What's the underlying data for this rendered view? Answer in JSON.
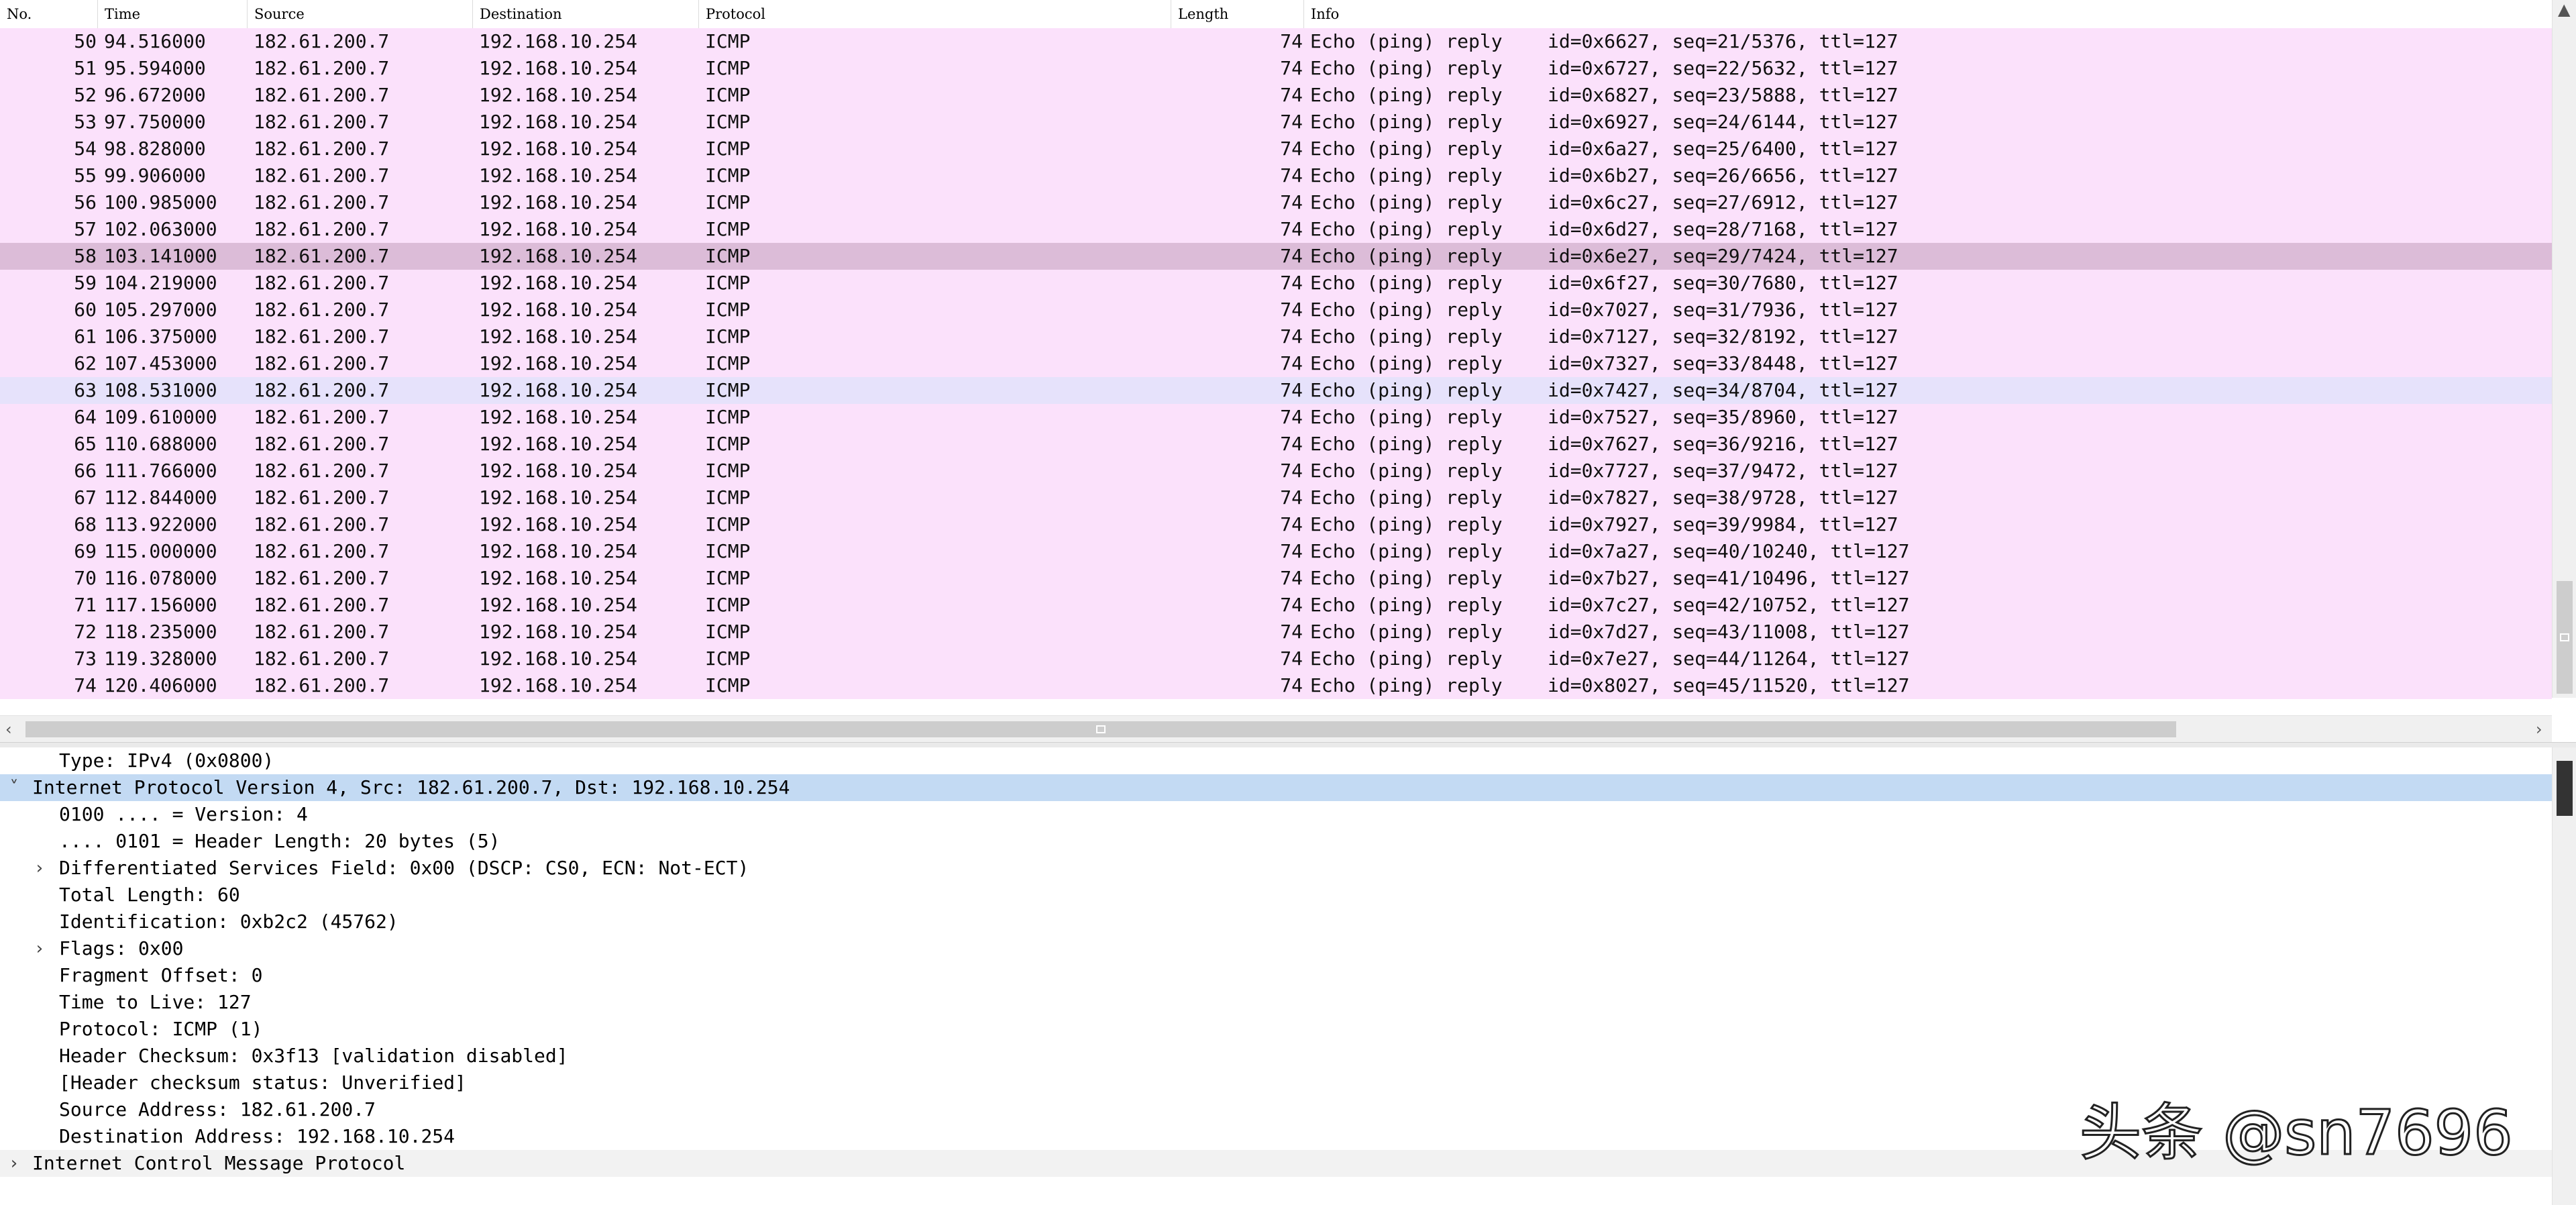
{
  "columns": {
    "no": "No.",
    "time": "Time",
    "source": "Source",
    "destination": "Destination",
    "protocol": "Protocol",
    "length": "Length",
    "info": "Info"
  },
  "packets": [
    {
      "no": "50",
      "time": "94.516000",
      "src": "182.61.200.7",
      "dst": "192.168.10.254",
      "proto": "ICMP",
      "len": "74",
      "info": "Echo (ping) reply    id=0x6627, seq=21/5376, ttl=127"
    },
    {
      "no": "51",
      "time": "95.594000",
      "src": "182.61.200.7",
      "dst": "192.168.10.254",
      "proto": "ICMP",
      "len": "74",
      "info": "Echo (ping) reply    id=0x6727, seq=22/5632, ttl=127"
    },
    {
      "no": "52",
      "time": "96.672000",
      "src": "182.61.200.7",
      "dst": "192.168.10.254",
      "proto": "ICMP",
      "len": "74",
      "info": "Echo (ping) reply    id=0x6827, seq=23/5888, ttl=127"
    },
    {
      "no": "53",
      "time": "97.750000",
      "src": "182.61.200.7",
      "dst": "192.168.10.254",
      "proto": "ICMP",
      "len": "74",
      "info": "Echo (ping) reply    id=0x6927, seq=24/6144, ttl=127"
    },
    {
      "no": "54",
      "time": "98.828000",
      "src": "182.61.200.7",
      "dst": "192.168.10.254",
      "proto": "ICMP",
      "len": "74",
      "info": "Echo (ping) reply    id=0x6a27, seq=25/6400, ttl=127"
    },
    {
      "no": "55",
      "time": "99.906000",
      "src": "182.61.200.7",
      "dst": "192.168.10.254",
      "proto": "ICMP",
      "len": "74",
      "info": "Echo (ping) reply    id=0x6b27, seq=26/6656, ttl=127"
    },
    {
      "no": "56",
      "time": "100.985000",
      "src": "182.61.200.7",
      "dst": "192.168.10.254",
      "proto": "ICMP",
      "len": "74",
      "info": "Echo (ping) reply    id=0x6c27, seq=27/6912, ttl=127"
    },
    {
      "no": "57",
      "time": "102.063000",
      "src": "182.61.200.7",
      "dst": "192.168.10.254",
      "proto": "ICMP",
      "len": "74",
      "info": "Echo (ping) reply    id=0x6d27, seq=28/7168, ttl=127"
    },
    {
      "no": "58",
      "time": "103.141000",
      "src": "182.61.200.7",
      "dst": "192.168.10.254",
      "proto": "ICMP",
      "len": "74",
      "info": "Echo (ping) reply    id=0x6e27, seq=29/7424, ttl=127",
      "state": "sel-gray"
    },
    {
      "no": "59",
      "time": "104.219000",
      "src": "182.61.200.7",
      "dst": "192.168.10.254",
      "proto": "ICMP",
      "len": "74",
      "info": "Echo (ping) reply    id=0x6f27, seq=30/7680, ttl=127"
    },
    {
      "no": "60",
      "time": "105.297000",
      "src": "182.61.200.7",
      "dst": "192.168.10.254",
      "proto": "ICMP",
      "len": "74",
      "info": "Echo (ping) reply    id=0x7027, seq=31/7936, ttl=127"
    },
    {
      "no": "61",
      "time": "106.375000",
      "src": "182.61.200.7",
      "dst": "192.168.10.254",
      "proto": "ICMP",
      "len": "74",
      "info": "Echo (ping) reply    id=0x7127, seq=32/8192, ttl=127"
    },
    {
      "no": "62",
      "time": "107.453000",
      "src": "182.61.200.7",
      "dst": "192.168.10.254",
      "proto": "ICMP",
      "len": "74",
      "info": "Echo (ping) reply    id=0x7327, seq=33/8448, ttl=127"
    },
    {
      "no": "63",
      "time": "108.531000",
      "src": "182.61.200.7",
      "dst": "192.168.10.254",
      "proto": "ICMP",
      "len": "74",
      "info": "Echo (ping) reply    id=0x7427, seq=34/8704, ttl=127",
      "state": "sel-blue"
    },
    {
      "no": "64",
      "time": "109.610000",
      "src": "182.61.200.7",
      "dst": "192.168.10.254",
      "proto": "ICMP",
      "len": "74",
      "info": "Echo (ping) reply    id=0x7527, seq=35/8960, ttl=127"
    },
    {
      "no": "65",
      "time": "110.688000",
      "src": "182.61.200.7",
      "dst": "192.168.10.254",
      "proto": "ICMP",
      "len": "74",
      "info": "Echo (ping) reply    id=0x7627, seq=36/9216, ttl=127"
    },
    {
      "no": "66",
      "time": "111.766000",
      "src": "182.61.200.7",
      "dst": "192.168.10.254",
      "proto": "ICMP",
      "len": "74",
      "info": "Echo (ping) reply    id=0x7727, seq=37/9472, ttl=127"
    },
    {
      "no": "67",
      "time": "112.844000",
      "src": "182.61.200.7",
      "dst": "192.168.10.254",
      "proto": "ICMP",
      "len": "74",
      "info": "Echo (ping) reply    id=0x7827, seq=38/9728, ttl=127"
    },
    {
      "no": "68",
      "time": "113.922000",
      "src": "182.61.200.7",
      "dst": "192.168.10.254",
      "proto": "ICMP",
      "len": "74",
      "info": "Echo (ping) reply    id=0x7927, seq=39/9984, ttl=127"
    },
    {
      "no": "69",
      "time": "115.000000",
      "src": "182.61.200.7",
      "dst": "192.168.10.254",
      "proto": "ICMP",
      "len": "74",
      "info": "Echo (ping) reply    id=0x7a27, seq=40/10240, ttl=127"
    },
    {
      "no": "70",
      "time": "116.078000",
      "src": "182.61.200.7",
      "dst": "192.168.10.254",
      "proto": "ICMP",
      "len": "74",
      "info": "Echo (ping) reply    id=0x7b27, seq=41/10496, ttl=127"
    },
    {
      "no": "71",
      "time": "117.156000",
      "src": "182.61.200.7",
      "dst": "192.168.10.254",
      "proto": "ICMP",
      "len": "74",
      "info": "Echo (ping) reply    id=0x7c27, seq=42/10752, ttl=127"
    },
    {
      "no": "72",
      "time": "118.235000",
      "src": "182.61.200.7",
      "dst": "192.168.10.254",
      "proto": "ICMP",
      "len": "74",
      "info": "Echo (ping) reply    id=0x7d27, seq=43/11008, ttl=127"
    },
    {
      "no": "73",
      "time": "119.328000",
      "src": "182.61.200.7",
      "dst": "192.168.10.254",
      "proto": "ICMP",
      "len": "74",
      "info": "Echo (ping) reply    id=0x7e27, seq=44/11264, ttl=127"
    },
    {
      "no": "74",
      "time": "120.406000",
      "src": "182.61.200.7",
      "dst": "192.168.10.254",
      "proto": "ICMP",
      "len": "74",
      "info": "Echo (ping) reply    id=0x8027, seq=45/11520, ttl=127"
    }
  ],
  "details": [
    {
      "text": "Type: IPv4 (0x0800)",
      "indent": 1,
      "twisty": ""
    },
    {
      "text": "Internet Protocol Version 4, Src: 182.61.200.7, Dst: 192.168.10.254",
      "indent": 0,
      "twisty": "expanded",
      "state": "hl"
    },
    {
      "text": "0100 .... = Version: 4",
      "indent": 1,
      "twisty": ""
    },
    {
      "text": ".... 0101 = Header Length: 20 bytes (5)",
      "indent": 1,
      "twisty": ""
    },
    {
      "text": "Differentiated Services Field: 0x00 (DSCP: CS0, ECN: Not-ECT)",
      "indent": 1,
      "twisty": "collapsed"
    },
    {
      "text": "Total Length: 60",
      "indent": 1,
      "twisty": ""
    },
    {
      "text": "Identification: 0xb2c2 (45762)",
      "indent": 1,
      "twisty": ""
    },
    {
      "text": "Flags: 0x00",
      "indent": 1,
      "twisty": "collapsed"
    },
    {
      "text": "Fragment Offset: 0",
      "indent": 1,
      "twisty": ""
    },
    {
      "text": "Time to Live: 127",
      "indent": 1,
      "twisty": ""
    },
    {
      "text": "Protocol: ICMP (1)",
      "indent": 1,
      "twisty": ""
    },
    {
      "text": "Header Checksum: 0x3f13 [validation disabled]",
      "indent": 1,
      "twisty": ""
    },
    {
      "text": "[Header checksum status: Unverified]",
      "indent": 1,
      "twisty": ""
    },
    {
      "text": "Source Address: 182.61.200.7",
      "indent": 1,
      "twisty": ""
    },
    {
      "text": "Destination Address: 192.168.10.254",
      "indent": 1,
      "twisty": ""
    },
    {
      "text": "Internet Control Message Protocol",
      "indent": 0,
      "twisty": "collapsed",
      "state": "ctrl-hl"
    }
  ],
  "icons": {
    "expanded": "chevron-down-icon",
    "collapsed": "chevron-right-icon"
  },
  "watermark": "头条 @sn7696",
  "colors": {
    "row_icmp": "#fbe1fb",
    "row_selected": "#dcbcd8",
    "row_marked": "#e6e2fb",
    "detail_selected": "#c3daf3"
  }
}
